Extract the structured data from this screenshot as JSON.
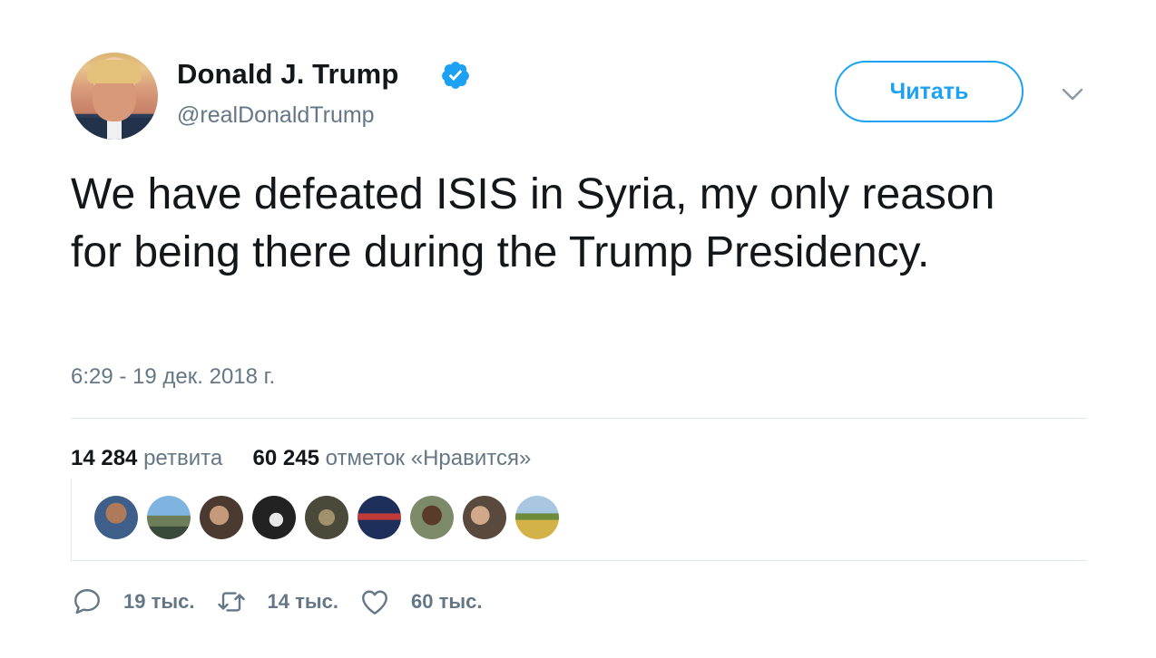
{
  "author": {
    "name": "Donald J. Trump",
    "handle": "@realDonaldTrump",
    "verified": true
  },
  "follow_button": {
    "label": "Читать"
  },
  "tweet": {
    "text": "We have defeated ISIS in Syria, my only reason for being there during the Trump Presidency.",
    "timestamp": "6:29 - 19 дек. 2018 г."
  },
  "stats": {
    "retweets_count": "14 284",
    "retweets_label": "ретвита",
    "likes_count": "60 245",
    "likes_label": "отметок «Нравится»"
  },
  "actions": {
    "replies": "19 тыс.",
    "retweets": "14 тыс.",
    "likes": "60 тыс."
  },
  "colors": {
    "accent": "#1da1f2",
    "muted": "#657786",
    "text": "#14171a",
    "divider": "#e1e8ed"
  },
  "icons": [
    "verified-badge-icon",
    "chevron-down-icon",
    "reply-icon",
    "retweet-icon",
    "like-icon"
  ]
}
